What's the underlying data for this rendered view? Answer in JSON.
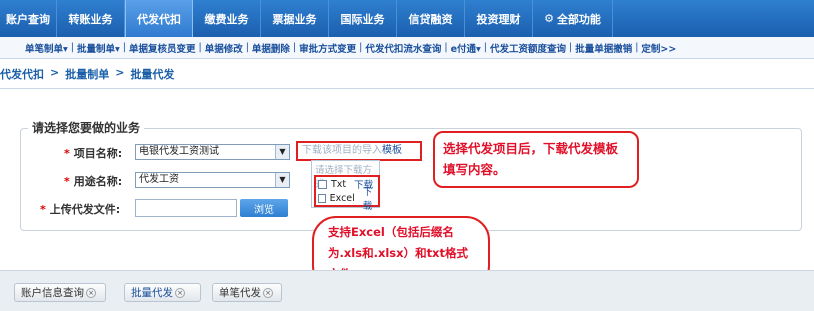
{
  "topnav": {
    "tabs": [
      "账户查询",
      "转账业务",
      "代发代扣",
      "缴费业务",
      "票据业务",
      "国际业务",
      "信贷融资",
      "投资理财",
      "全部功能"
    ],
    "all_icon": "gear-icon"
  },
  "subnav": {
    "items": [
      "单笔制单▾",
      "批量制单▾",
      "单据复核员变更",
      "单据修改",
      "单据删除",
      "审批方式变更",
      "代发代扣流水查询",
      "e付通▾",
      "代发工资额度查询",
      "批量单据撤销",
      "定制>>"
    ]
  },
  "breadcrumb": {
    "a": "代发代扣",
    "b": "批量制单",
    "c": "批量代发",
    "sep": ">"
  },
  "form": {
    "legend": "请选择您要做的业务",
    "req": "*",
    "project_label": "项目名称:",
    "project_value": "电银代发工资测试",
    "purpose_label": "用途名称:",
    "purpose_value": "代发工资",
    "file_label": "上传代发文件:",
    "browse": "浏览",
    "download_link_faded": "下载该项目的导入",
    "download_link": "模板",
    "dropdown_hint": "请选择下载方式:",
    "txt_label": "Txt",
    "excel_label": "Excel",
    "download_word": "下载"
  },
  "callouts": {
    "one": "选择代发项目后，下载代发模板填写内容。",
    "two": "支持Excel（包括后缀名为.xls和.xlsx）和txt格式文件"
  },
  "bottom_tabs": [
    "账户信息查询",
    "批量代发",
    "单笔代发"
  ]
}
